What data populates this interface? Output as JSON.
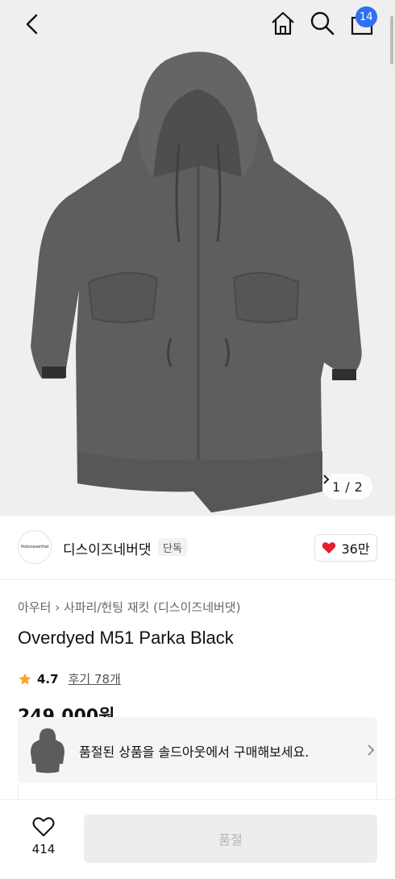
{
  "header": {
    "cart_count": "14"
  },
  "gallery": {
    "current": "1",
    "total": "2",
    "separator": "/"
  },
  "brand": {
    "name": "디스이즈네버댓",
    "tag": "단독",
    "logo_text": "thisisneverthat",
    "likes": "36만"
  },
  "product": {
    "breadcrumb_category": "아우터",
    "breadcrumb_sub": "사파리/헌팅 재킷 (디스이즈네버댓)",
    "title": "Overdyed M51 Parka Black",
    "rating": "4.7",
    "reviews": "후기 78개",
    "price": "249,000원"
  },
  "soldout_banner": {
    "text": "품절된 상품을 솔드아웃에서 구매해보세요."
  },
  "bottom": {
    "wish_count": "414",
    "buy_label": "품절"
  },
  "colors": {
    "accent": "#2f6ff2",
    "heart": "#e3202c",
    "star": "#f5a623",
    "jacket": "#5b5c5c"
  }
}
